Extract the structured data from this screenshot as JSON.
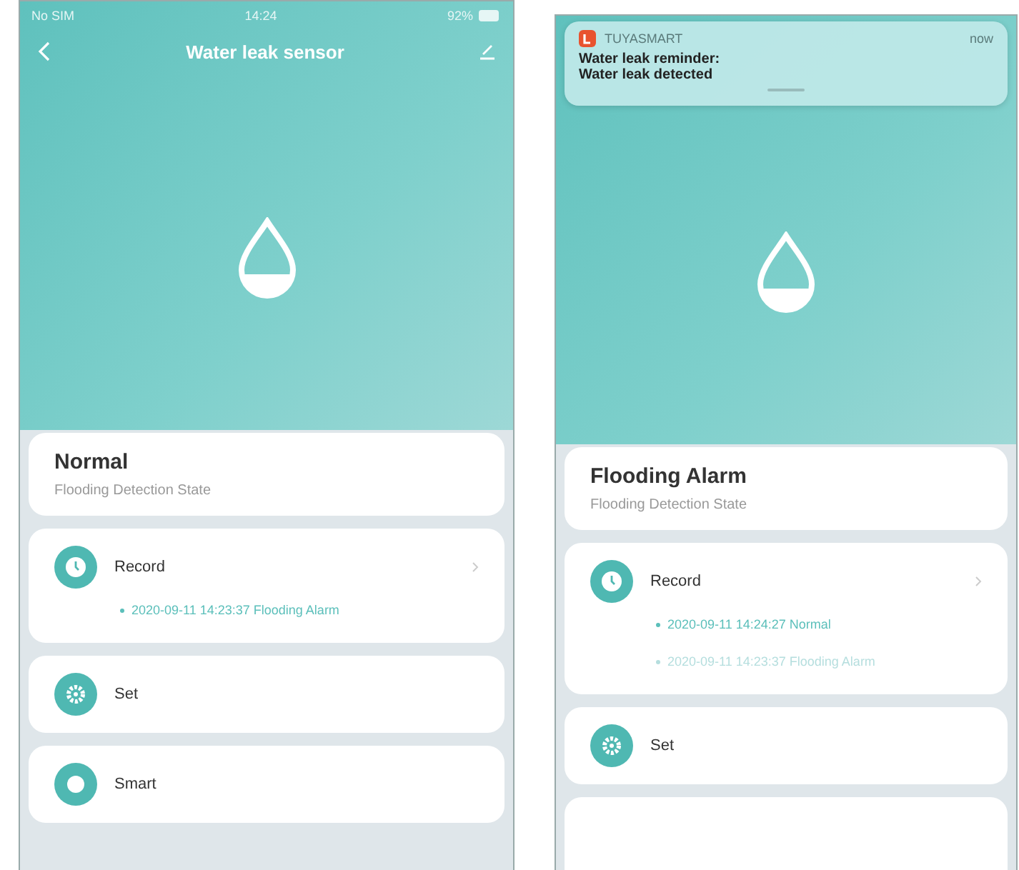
{
  "phones": [
    {
      "status_bar": {
        "carrier": "No SIM",
        "time": "14:24",
        "battery": "92%"
      },
      "nav": {
        "title": "Water leak sensor"
      },
      "state": "Normal",
      "state_caption": "Flooding Detection State",
      "menu": [
        {
          "kind": "record",
          "label": "Record",
          "entries": [
            {
              "text": "2020-09-11 14:23:37 Flooding Alarm",
              "dimmed": false
            }
          ]
        },
        {
          "kind": "set",
          "label": "Set"
        },
        {
          "kind": "smart",
          "label": "Smart"
        }
      ]
    },
    {
      "notification": {
        "app": "TUYASMART",
        "time": "now",
        "title": "Water leak reminder:",
        "body": "Water leak detected"
      },
      "state": "Flooding Alarm",
      "state_caption": "Flooding Detection State",
      "menu": [
        {
          "kind": "record",
          "label": "Record",
          "entries": [
            {
              "text": "2020-09-11 14:24:27 Normal",
              "dimmed": false
            },
            {
              "text": "2020-09-11 14:23:37 Flooding Alarm",
              "dimmed": true
            }
          ]
        },
        {
          "kind": "set",
          "label": "Set"
        },
        {
          "kind": "empty"
        }
      ]
    }
  ]
}
